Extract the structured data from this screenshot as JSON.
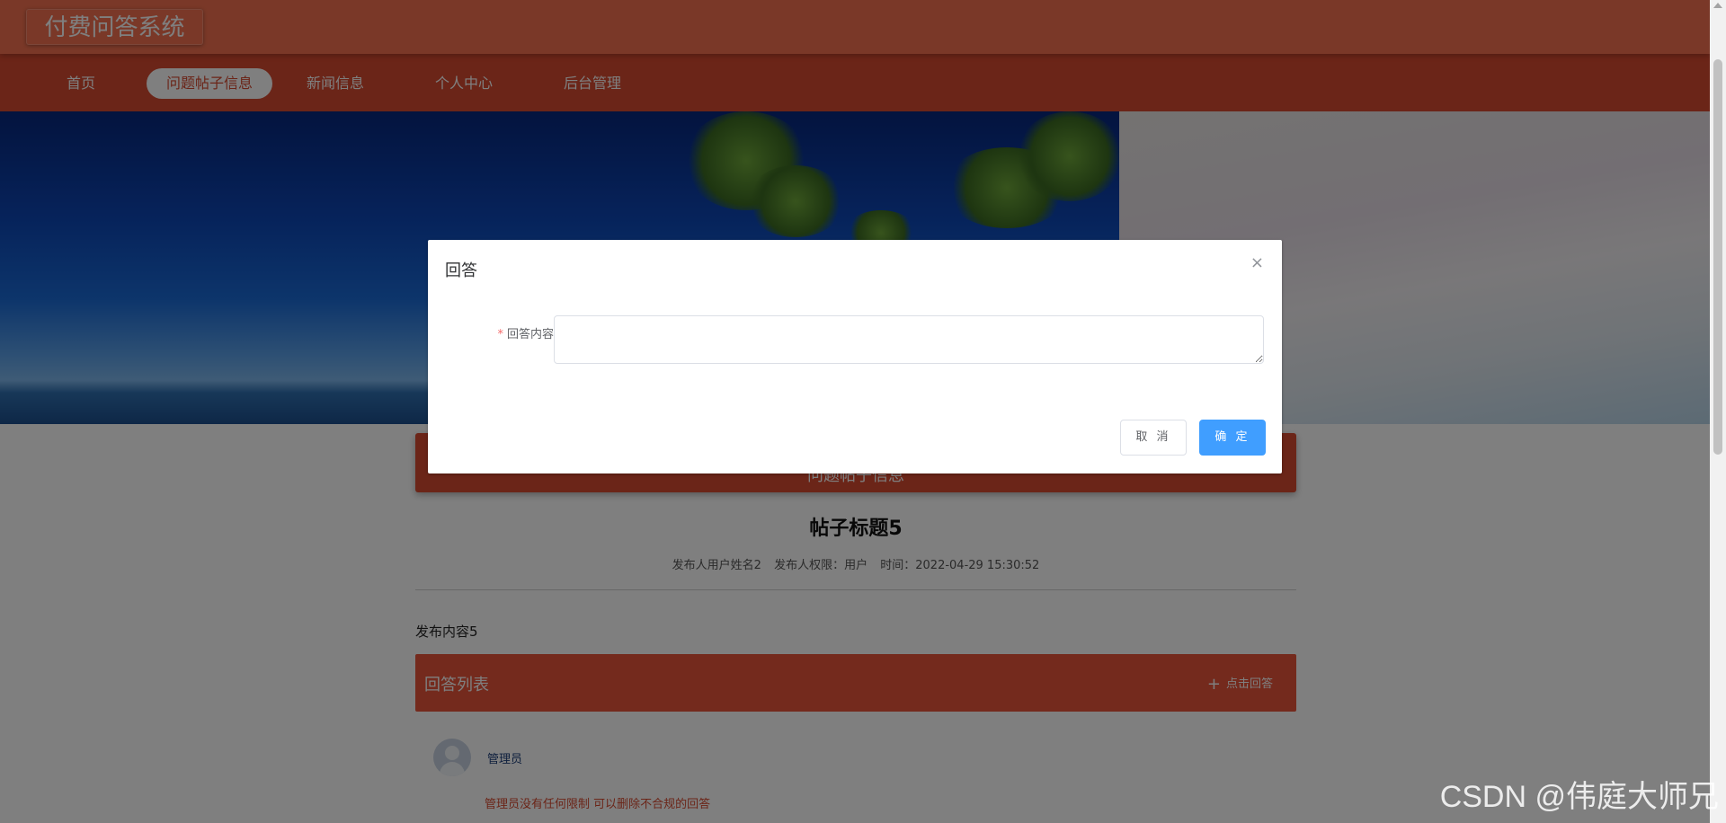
{
  "app": {
    "title": "付费问答系统"
  },
  "nav": {
    "items": [
      {
        "label": "首页"
      },
      {
        "label": "问题帖子信息"
      },
      {
        "label": "新闻信息"
      },
      {
        "label": "个人中心"
      },
      {
        "label": "后台管理"
      }
    ],
    "active_index": 1
  },
  "section": {
    "title": "问题帖子信息"
  },
  "post": {
    "title": "帖子标题5",
    "author": "发布人用户姓名2",
    "role": "发布人权限：用户",
    "time": "时间：2022-04-29 15:30:52",
    "content": "发布内容5"
  },
  "answers": {
    "title": "回答列表",
    "add_label": "点击回答",
    "items": [
      {
        "user": "管理员",
        "text": "管理员没有任何限制 可以删除不合规的回答"
      }
    ]
  },
  "dialog": {
    "title": "回答",
    "close_glyph": "×",
    "field_label": "回答内容",
    "required_mark": "*",
    "field_value": "",
    "cancel_label": "取 消",
    "ok_label": "确 定"
  },
  "watermark": "CSDN @伟庭大师兄",
  "colors": {
    "header": "#f47150",
    "nav": "#d74a30",
    "primary_button": "#409eff"
  }
}
